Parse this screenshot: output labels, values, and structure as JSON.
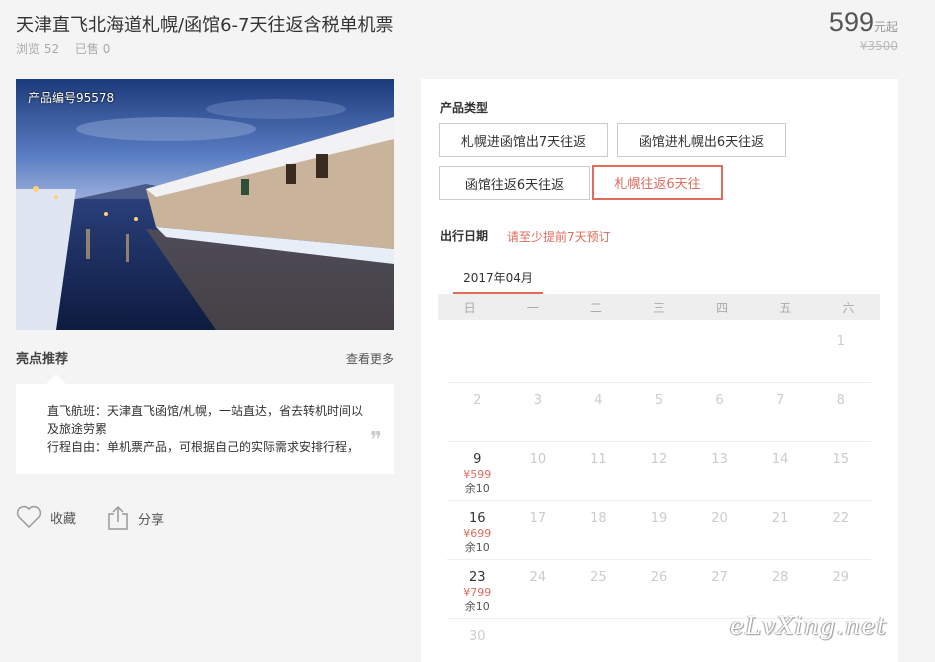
{
  "product": {
    "title": "天津直飞北海道札幌/函馆6-7天往返含税单机票",
    "views": "浏览 52",
    "sold": "已售 0",
    "price": "599",
    "price_unit": "元起",
    "original_price": "¥3500",
    "photo_code": "产品编号95578"
  },
  "highlights": {
    "title": "亮点推荐",
    "more": "查看更多",
    "line1": "直飞航班：天津直飞函馆/札幌，一站直达，省去转机时间以",
    "line2": "及旅途劳累",
    "line3": "行程自由：单机票产品，可根据自己的实际需求安排行程，",
    "quote": "❞"
  },
  "actions": {
    "favorite": "收藏",
    "share": "分享"
  },
  "booking": {
    "type_label": "产品类型",
    "options": [
      "札幌进函馆出7天往返",
      "函馆进札幌出6天往返",
      "函馆往返6天往返",
      "札幌往返6天往"
    ],
    "date_label": "出行日期",
    "date_tip": "请至少提前7天预订",
    "month": "2017年04月",
    "weekdays": [
      "日",
      "一",
      "二",
      "三",
      "四",
      "五",
      "六"
    ]
  },
  "calendar": [
    [
      {
        "d": ""
      },
      {
        "d": ""
      },
      {
        "d": ""
      },
      {
        "d": ""
      },
      {
        "d": ""
      },
      {
        "d": ""
      },
      {
        "d": "1"
      }
    ],
    [
      {
        "d": "2"
      },
      {
        "d": "3"
      },
      {
        "d": "4"
      },
      {
        "d": "5"
      },
      {
        "d": "6"
      },
      {
        "d": "7"
      },
      {
        "d": "8"
      }
    ],
    [
      {
        "d": "9",
        "p": "¥599",
        "r": "余10"
      },
      {
        "d": "10"
      },
      {
        "d": "11"
      },
      {
        "d": "12"
      },
      {
        "d": "13"
      },
      {
        "d": "14"
      },
      {
        "d": "15"
      }
    ],
    [
      {
        "d": "16",
        "p": "¥699",
        "r": "余10"
      },
      {
        "d": "17"
      },
      {
        "d": "18"
      },
      {
        "d": "19"
      },
      {
        "d": "20"
      },
      {
        "d": "21"
      },
      {
        "d": "22"
      }
    ],
    [
      {
        "d": "23",
        "p": "¥799",
        "r": "余10"
      },
      {
        "d": "24"
      },
      {
        "d": "25"
      },
      {
        "d": "26"
      },
      {
        "d": "27"
      },
      {
        "d": "28"
      },
      {
        "d": "29"
      }
    ],
    [
      {
        "d": "30"
      },
      {
        "d": ""
      },
      {
        "d": ""
      },
      {
        "d": ""
      },
      {
        "d": ""
      },
      {
        "d": ""
      },
      {
        "d": ""
      }
    ]
  ],
  "watermark": "eLvXing.net",
  "colors": {
    "accent": "#e06c5c",
    "background": "#f4f4f4"
  }
}
